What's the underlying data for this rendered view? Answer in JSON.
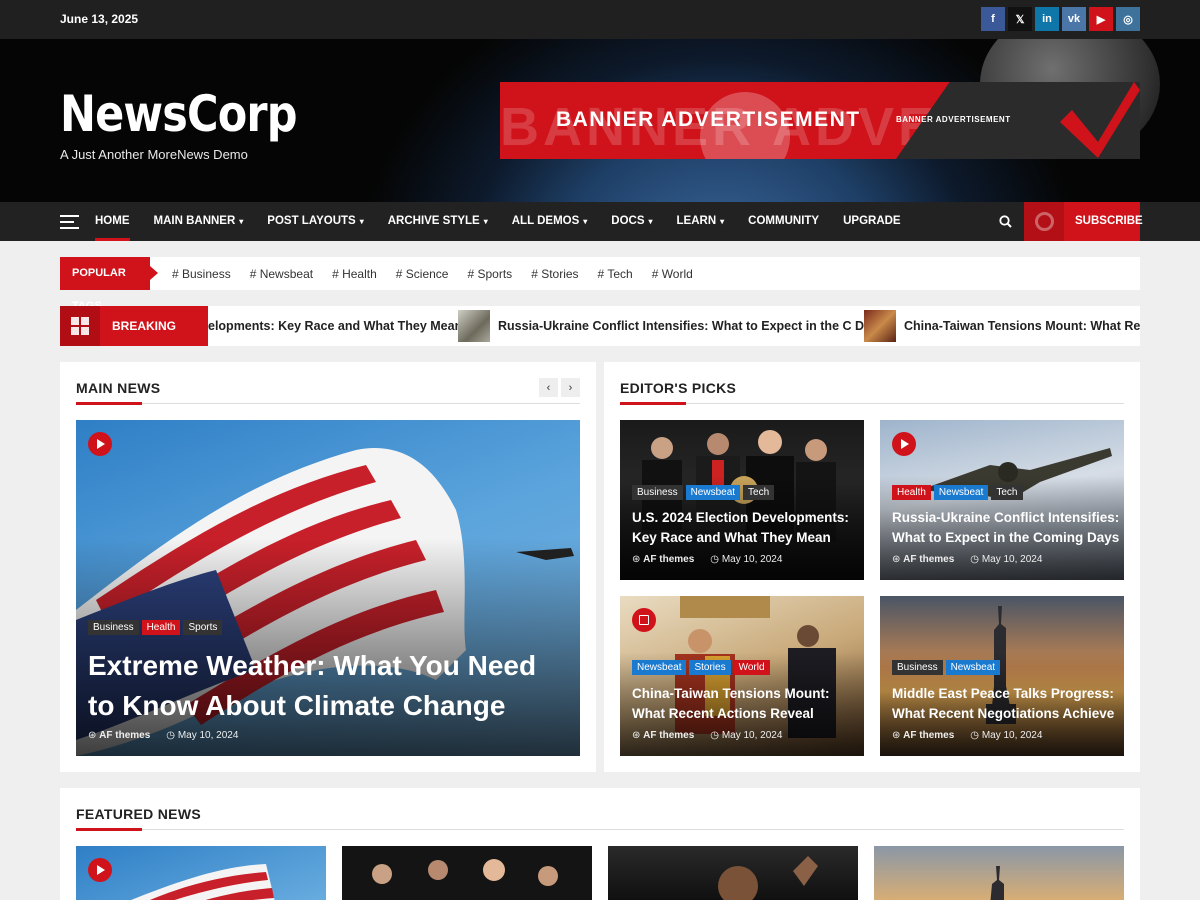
{
  "topbar": {
    "date": "June 13, 2025"
  },
  "socials": [
    {
      "icon": "facebook-icon",
      "glyph": "f",
      "color": "#3b5998"
    },
    {
      "icon": "x-icon",
      "glyph": "𝕏",
      "color": "#111111"
    },
    {
      "icon": "linkedin-icon",
      "glyph": "in",
      "color": "#0e76a8"
    },
    {
      "icon": "vk-icon",
      "glyph": "vk",
      "color": "#4a76a8"
    },
    {
      "icon": "youtube-icon",
      "glyph": "▶",
      "color": "#d0121a"
    },
    {
      "icon": "instagram-icon",
      "glyph": "◎",
      "color": "#3f729b"
    }
  ],
  "header": {
    "site_title": "NewsCorp",
    "tagline": "A Just Another MoreNews Demo",
    "banner_main": "BANNER ADVERTISEMENT",
    "banner_small": "BANNER ADVERTISEMENT",
    "banner_ghost": "BANNER ADVERTISEME"
  },
  "nav": {
    "items": [
      {
        "label": "HOME"
      },
      {
        "label": "MAIN BANNER"
      },
      {
        "label": "POST LAYOUTS"
      },
      {
        "label": "ARCHIVE STYLE"
      },
      {
        "label": "ALL DEMOS"
      },
      {
        "label": "DOCS"
      },
      {
        "label": "LEARN"
      },
      {
        "label": "COMMUNITY"
      },
      {
        "label": "UPGRADE"
      }
    ],
    "caret": "▾",
    "subscribe": "SUBSCRIBE"
  },
  "tags": {
    "label": "POPULAR TAGS",
    "items": [
      "# Business",
      "# Newsbeat",
      "# Health",
      "# Science",
      "# Sports",
      "# Stories",
      "# Tech",
      "# World"
    ]
  },
  "breaking": {
    "label": "BREAKING NEWS",
    "items": [
      "elopments: Key Race and What They Mean",
      "Russia-Ukraine Conflict Intensifies: What to Expect in the C Days",
      "China-Taiwan Tensions Mount: What Recent A"
    ]
  },
  "main_news": {
    "title": "MAIN NEWS",
    "prev": "‹",
    "next": "›",
    "badges": [
      "Business",
      "Health",
      "Sports"
    ],
    "headline": "Extreme Weather: What You Need to Know About Climate Change",
    "author": "AF themes",
    "date": "May 10, 2024"
  },
  "editors_picks": {
    "title": "EDITOR'S PICKS",
    "items": [
      {
        "badges": [
          "Business",
          "Newsbeat",
          "Tech"
        ],
        "headline": "U.S. 2024 Election Developments: Key Race and What They Mean",
        "author": "AF themes",
        "date": "May 10, 2024"
      },
      {
        "badges": [
          "Health",
          "Newsbeat",
          "Tech"
        ],
        "headline": "Russia-Ukraine Conflict Intensifies: What to Expect in the Coming Days",
        "author": "AF themes",
        "date": "May 10, 2024"
      },
      {
        "badges": [
          "Newsbeat",
          "Stories",
          "World"
        ],
        "headline": "China-Taiwan Tensions Mount: What Recent Actions Reveal",
        "author": "AF themes",
        "date": "May 10, 2024"
      },
      {
        "badges": [
          "Business",
          "Newsbeat"
        ],
        "headline": "Middle East Peace Talks Progress: What Recent Negotiations Achieve",
        "author": "AF themes",
        "date": "May 10, 2024"
      }
    ]
  },
  "featured": {
    "title": "FEATURED NEWS"
  },
  "colors": {
    "accent": "#d0121a",
    "blue_badge": "#1a7ad0",
    "dark": "#222222"
  }
}
